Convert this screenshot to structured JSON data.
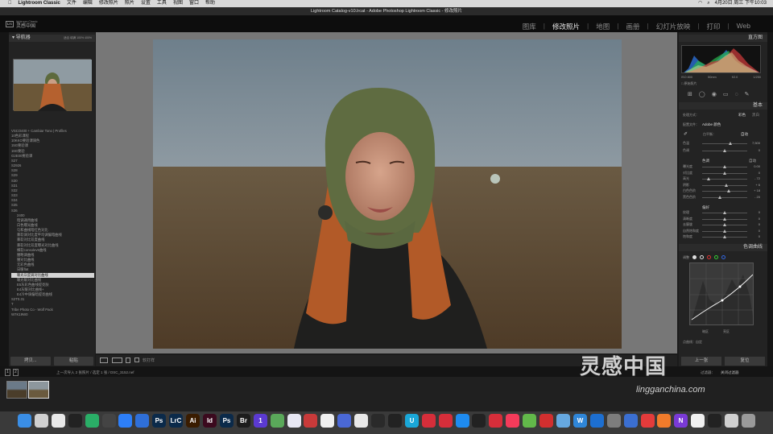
{
  "menubar": {
    "app": "Lightroom Classic",
    "items": [
      "文件",
      "编辑",
      "修改照片",
      "照片",
      "设置",
      "工具",
      "视图",
      "窗口",
      "帮助"
    ],
    "clock": "4月20日 周三 下午10:03"
  },
  "window_title": "Lightroom Catalog-v10.lrcat - Adobe Photoshop Lightroom Classic - 修改照片",
  "catalog": {
    "badge": "Lrc",
    "line1": "灵感中国",
    "line2": "lightroom Classic"
  },
  "modules": [
    {
      "label": "图库",
      "active": false
    },
    {
      "label": "修改照片",
      "active": true
    },
    {
      "label": "地图",
      "active": false
    },
    {
      "label": "画册",
      "active": false
    },
    {
      "label": "幻灯片放映",
      "active": false
    },
    {
      "label": "打印",
      "active": false
    },
    {
      "label": "Web",
      "active": false
    }
  ],
  "navigator": {
    "title": "导航器",
    "zoom": "适合  填满  100%  400%"
  },
  "presets": [
    {
      "label": "VSCO400 + Cambiar Tono | Profiles",
      "sub": false
    },
    {
      "label": "10色彩课程",
      "sub": false
    },
    {
      "label": "10KKO要验课调色",
      "sub": false
    },
    {
      "label": "15G要验课",
      "sub": false
    },
    {
      "label": "16G要验",
      "sub": false
    },
    {
      "label": "G2E00要验课",
      "sub": false
    },
    {
      "label": "S27",
      "sub": false
    },
    {
      "label": "S2926",
      "sub": false
    },
    {
      "label": "S28",
      "sub": false
    },
    {
      "label": "S29",
      "sub": false
    },
    {
      "label": "S30",
      "sub": false
    },
    {
      "label": "S31",
      "sub": false
    },
    {
      "label": "S32",
      "sub": false
    },
    {
      "label": "S33",
      "sub": false
    },
    {
      "label": "S34",
      "sub": false
    },
    {
      "label": "S35",
      "sub": false
    },
    {
      "label": "S36",
      "sub": false
    },
    {
      "label": "2400",
      "sub": true
    },
    {
      "label": "暗调通用曲线",
      "sub": true
    },
    {
      "label": "白色曝光曲线",
      "sub": true
    },
    {
      "label": "匀和曲线暗红色对比",
      "sub": true
    },
    {
      "label": "暴软调对比度平均调偏暗曲线",
      "sub": true
    },
    {
      "label": "暴软对比双度曲线",
      "sub": true
    },
    {
      "label": "暴软对比双度曝光对比曲线",
      "sub": true
    },
    {
      "label": "横软consolev5曲线",
      "sub": true
    },
    {
      "label": "腰略调曲线",
      "sub": true
    },
    {
      "label": "腰对比曲线",
      "sub": true
    },
    {
      "label": "无彩色曲线",
      "sub": true
    },
    {
      "label": "日暖flat",
      "sub": true
    },
    {
      "label": "暖光灰度调对比曲线",
      "sub": true,
      "selected": true
    },
    {
      "label": "暖光暖对比曲线",
      "sub": true
    },
    {
      "label": "E5灰彩色曲线提亮肤",
      "sub": true
    },
    {
      "label": "E4灰暖对比曲线+",
      "sub": true
    },
    {
      "label": "E4冷中调偏暗提亮曲线",
      "sub": true
    },
    {
      "label": "S2T0.31",
      "sub": false
    },
    {
      "label": "T",
      "sub": false
    },
    {
      "label": "Tribe Photo Co - Wolf Pack",
      "sub": false
    },
    {
      "label": "W7K19W0",
      "sub": false
    }
  ],
  "left_buttons": {
    "copy": "拷贝...",
    "paste": "粘贴"
  },
  "toolbar": {
    "softproof": "软打样"
  },
  "right_panel": {
    "histogram_title": "直方图",
    "histogram_info": [
      "ISO 800",
      "50mm",
      "f/2.0",
      "1/250"
    ],
    "original_label": "□ 原始照片",
    "basic_title": "基本",
    "treatment_label": "处理方式：",
    "treatment_options": [
      "彩色",
      "黑白"
    ],
    "profile_label": "配置文件：",
    "profile_value": "Adobe 颜色",
    "wb_label": "白平衡：",
    "wb_value": "自动",
    "tone_label": "色调",
    "tone_auto": "自动",
    "presence_label": "偏好",
    "curve_title": "色调曲线",
    "curve_adjust": "调整",
    "curve_channel": "通道：RGB",
    "curve_points": "点曲线：自定",
    "sliders_wb": [
      {
        "label": "色温",
        "value": "7,500",
        "pos": 0.62
      },
      {
        "label": "色调",
        "value": "0",
        "pos": 0.5
      }
    ],
    "sliders_tone": [
      {
        "label": "曝光度",
        "value": "0.00",
        "pos": 0.5
      },
      {
        "label": "对比度",
        "value": "0",
        "pos": 0.5
      },
      {
        "label": "高光",
        "value": "- 72",
        "pos": 0.14
      },
      {
        "label": "阴影",
        "value": "+ 6",
        "pos": 0.53
      },
      {
        "label": "白色色阶",
        "value": "+ 18",
        "pos": 0.59
      },
      {
        "label": "黑色色阶",
        "value": "- 20",
        "pos": 0.4
      }
    ],
    "sliders_presence": [
      {
        "label": "纹理",
        "value": "0",
        "pos": 0.5
      },
      {
        "label": "清晰度",
        "value": "0",
        "pos": 0.5
      },
      {
        "label": "去朦胧",
        "value": "0",
        "pos": 0.5
      },
      {
        "label": "自然饱和度",
        "value": "0",
        "pos": 0.5
      },
      {
        "label": "饱和度",
        "value": "0",
        "pos": 0.5
      }
    ],
    "region_labels": [
      "暗区",
      "亮区"
    ],
    "bottom_buttons": [
      "上一张",
      "复位"
    ]
  },
  "filmstrip": {
    "page1": "1",
    "page2": "2",
    "info": "上一次导入  2 张照片 / 选定 1 张 / DSC_3152.nef",
    "filter": "过滤器：",
    "filter_value": "关闭过滤器"
  },
  "watermark": {
    "text": "灵感中国",
    "url": "lingganchina.com"
  },
  "dock": [
    {
      "name": "finder",
      "label": "",
      "color": "#3a8ee6"
    },
    {
      "name": "launchpad",
      "label": "",
      "color": "#d0d0d0"
    },
    {
      "name": "chrome",
      "label": "",
      "color": "#e8e8e8"
    },
    {
      "name": "app-penguin",
      "label": "",
      "color": "#222"
    },
    {
      "name": "wechat",
      "label": "",
      "color": "#2aae67"
    },
    {
      "name": "app-dots",
      "label": "",
      "color": "#444"
    },
    {
      "name": "app-blue-circle",
      "label": "",
      "color": "#2d7ff9"
    },
    {
      "name": "app-meet",
      "label": "",
      "color": "#2f6fd8"
    },
    {
      "name": "photoshop-1",
      "label": "Ps",
      "color": "#0b2a4a"
    },
    {
      "name": "lightroom-classic",
      "label": "LrC",
      "color": "#0b2a4a"
    },
    {
      "name": "illustrator",
      "label": "Ai",
      "color": "#3a1c00"
    },
    {
      "name": "indesign",
      "label": "Id",
      "color": "#3b0a1e"
    },
    {
      "name": "photoshop-2",
      "label": "Ps",
      "color": "#0b2a4a"
    },
    {
      "name": "bridge",
      "label": "Br",
      "color": "#1c1c1c"
    },
    {
      "name": "app-one",
      "label": "1",
      "color": "#5b3ad1"
    },
    {
      "name": "app-maps",
      "label": "",
      "color": "#5aa85a"
    },
    {
      "name": "app-share",
      "label": "",
      "color": "#e8e8f4"
    },
    {
      "name": "app-game",
      "label": "",
      "color": "#c83a3a"
    },
    {
      "name": "photos",
      "label": "",
      "color": "#f0f0f0"
    },
    {
      "name": "app-vector",
      "label": "",
      "color": "#4a68d6"
    },
    {
      "name": "app-shield",
      "label": "",
      "color": "#e8e8e8"
    },
    {
      "name": "final-cut",
      "label": "",
      "color": "#2a2a2a"
    },
    {
      "name": "app-arrow",
      "label": "",
      "color": "#222"
    },
    {
      "name": "app-u",
      "label": "U",
      "color": "#1aa7d8"
    },
    {
      "name": "app-red-1",
      "label": "",
      "color": "#d62e3a"
    },
    {
      "name": "app-red-2",
      "label": "",
      "color": "#d62e3a"
    },
    {
      "name": "app-store",
      "label": "",
      "color": "#1e8bf0"
    },
    {
      "name": "app-wave",
      "label": "",
      "color": "#222"
    },
    {
      "name": "netease-music",
      "label": "",
      "color": "#d62e3a"
    },
    {
      "name": "music",
      "label": "",
      "color": "#f43b5a"
    },
    {
      "name": "app-green",
      "label": "",
      "color": "#62b84a"
    },
    {
      "name": "app-red-3",
      "label": "",
      "color": "#d12f2f"
    },
    {
      "name": "app-bird",
      "label": "",
      "color": "#66a8e0"
    },
    {
      "name": "app-w",
      "label": "W",
      "color": "#2f86d8"
    },
    {
      "name": "app-blue-2",
      "label": "",
      "color": "#1d6fd1"
    },
    {
      "name": "system-prefs",
      "label": "",
      "color": "#7d7d7d"
    },
    {
      "name": "app-globe",
      "label": "",
      "color": "#3b6fd1"
    },
    {
      "name": "creative-cloud",
      "label": "",
      "color": "#e33b3b"
    },
    {
      "name": "app-stripes",
      "label": "",
      "color": "#f07b2b"
    },
    {
      "name": "app-n",
      "label": "N",
      "color": "#7a3ad6"
    },
    {
      "name": "app-notes",
      "label": "",
      "color": "#f0f0f0"
    },
    {
      "name": "app-pen",
      "label": "",
      "color": "#222"
    },
    {
      "name": "app-preview",
      "label": "",
      "color": "#d0d0d0"
    },
    {
      "name": "trash",
      "label": "",
      "color": "#9a9a9a"
    }
  ]
}
